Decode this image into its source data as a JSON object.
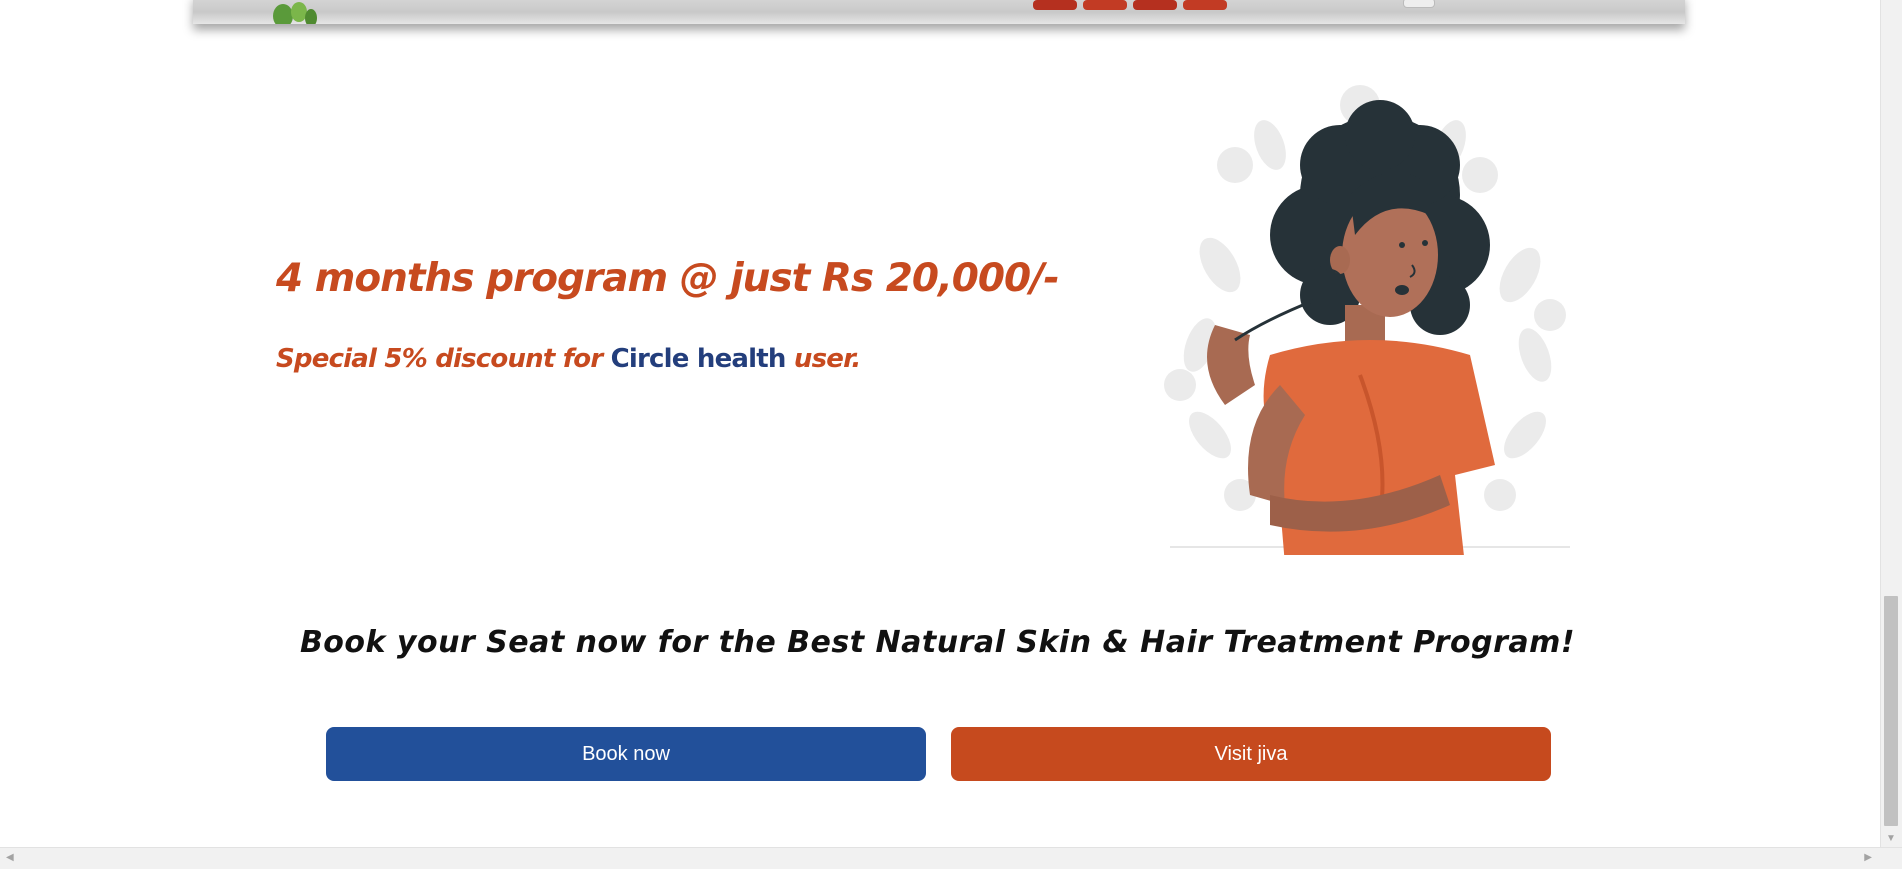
{
  "offer": {
    "program_text": "4 months program @ just Rs 20,000/-",
    "discount_prefix": "Special 5% discount for",
    "discount_brand": "Circle health",
    "discount_suffix": "user."
  },
  "cta": {
    "heading": "Book your Seat now for the Best Natural Skin & Hair Treatment Program!",
    "book_label": "Book now",
    "visit_label": "Visit jiva"
  },
  "colors": {
    "accent_orange": "#c64a1e",
    "accent_blue": "#22509a",
    "brand_navy": "#233e7c"
  },
  "icons": {
    "scroll_down": "▼",
    "scroll_left": "◀",
    "scroll_right": "▶"
  }
}
